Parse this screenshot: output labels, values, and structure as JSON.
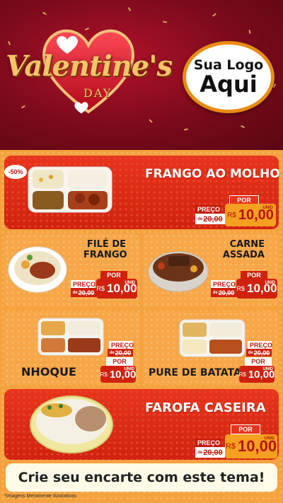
{
  "header": {
    "title_main": "Valentine's",
    "title_sub": "DAY",
    "logo_line1": "Sua Logo",
    "logo_line2": "Aqui"
  },
  "badge": "-50%",
  "products": [
    {
      "name_lines": [
        "FRANGO AO MOLHO"
      ],
      "preco_label": "PREÇO",
      "por_label": "POR",
      "old_prefix": "de",
      "old_price": "20,00",
      "currency": "R$",
      "price": "10,00",
      "unit": "UNID"
    },
    {
      "name_lines": [
        "FILÉ DE",
        "FRANGO"
      ],
      "preco_label": "PREÇO",
      "por_label": "POR",
      "old_prefix": "de",
      "old_price": "20,00",
      "currency": "R$",
      "price": "10,00",
      "unit": "UNID"
    },
    {
      "name_lines": [
        "CARNE",
        "ASSADA"
      ],
      "preco_label": "PREÇO",
      "por_label": "POR",
      "old_prefix": "de",
      "old_price": "20,00",
      "currency": "R$",
      "price": "10,00",
      "unit": "UNID"
    },
    {
      "name_lines": [
        "NHOQUE"
      ],
      "preco_label": "PREÇO",
      "por_label": "POR",
      "old_prefix": "de",
      "old_price": "20,00",
      "currency": "R$",
      "price": "10,00",
      "unit": "UNID"
    },
    {
      "name_lines": [
        "PURE DE BATATA"
      ],
      "preco_label": "PREÇO",
      "por_label": "POR",
      "old_prefix": "de",
      "old_price": "20,00",
      "currency": "R$",
      "price": "10,00",
      "unit": "UNID"
    },
    {
      "name_lines": [
        "FAROFA CASEIRA"
      ],
      "preco_label": "PREÇO",
      "por_label": "POR",
      "old_prefix": "de",
      "old_price": "20,00",
      "currency": "R$",
      "price": "10,00",
      "unit": "UNID"
    }
  ],
  "cta": "Crie seu encarte com este tema!",
  "footnote": "*Imagens Meramente Ilustrativas",
  "colors": {
    "red": "#d0210f",
    "orange": "#f4a23e",
    "header_red": "#7a0a1c",
    "gold": "#f7c46a"
  }
}
